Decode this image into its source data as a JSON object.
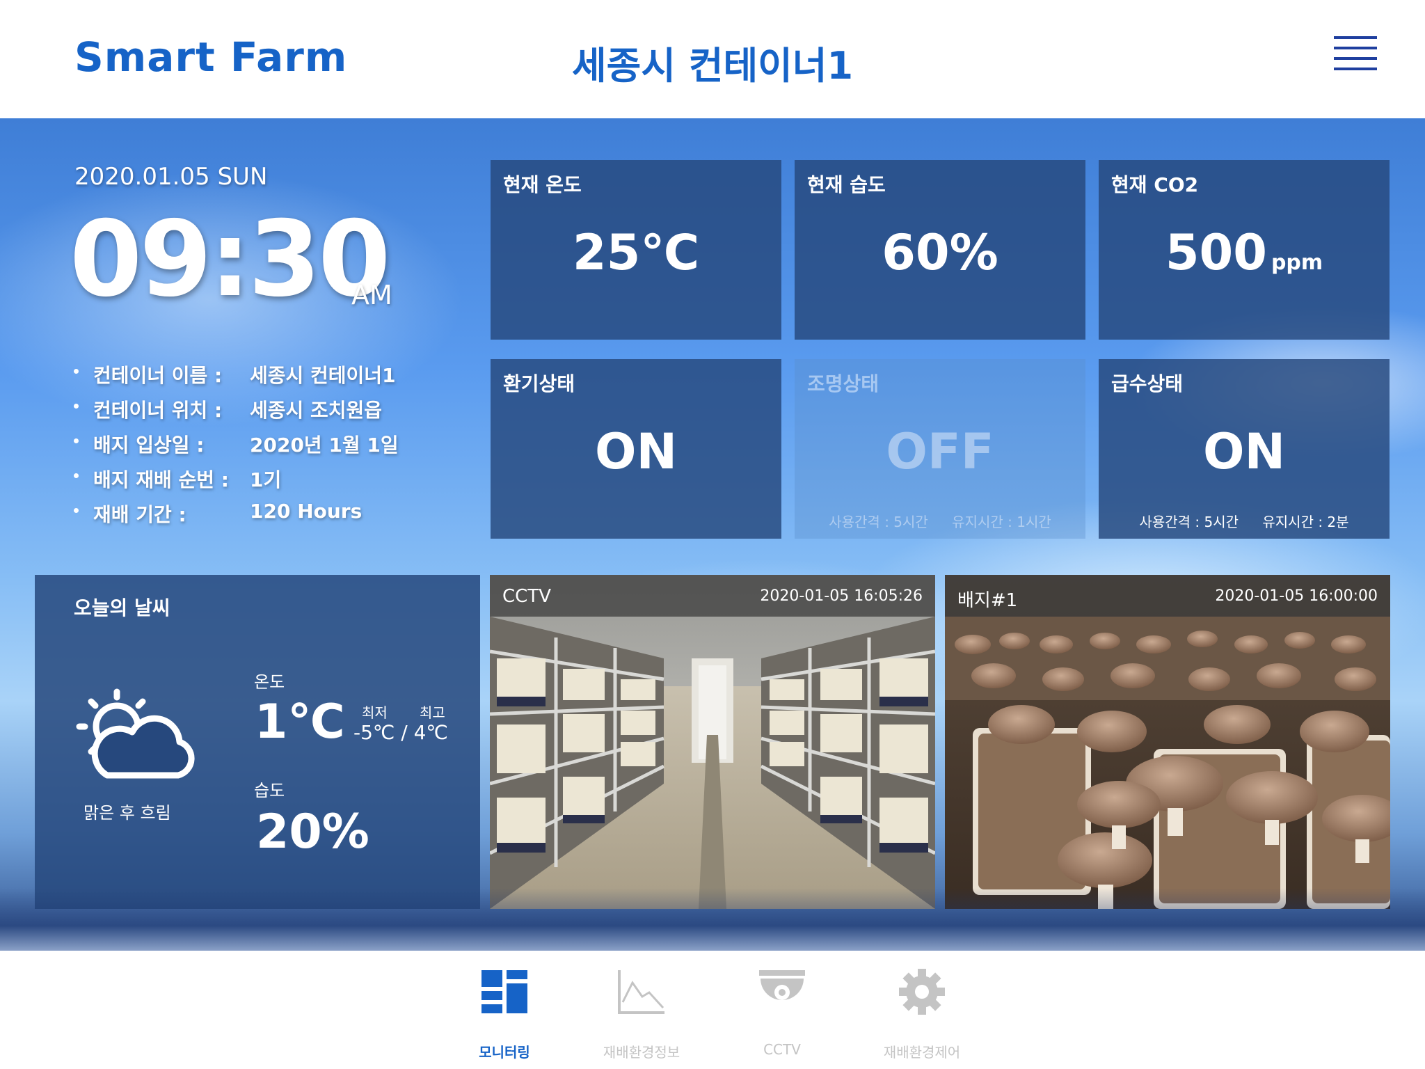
{
  "header": {
    "logo": "Smart Farm",
    "title": "세종시 컨테이너1",
    "menu_icon": "hamburger-menu-icon"
  },
  "clock": {
    "date": "2020.01.05 SUN",
    "time": "09:30",
    "ampm": "AM"
  },
  "info": [
    {
      "label": "컨테이너 이름 :",
      "value": "세종시 컨테이너1"
    },
    {
      "label": "컨테이너 위치 :",
      "value": "세종시 조치원읍"
    },
    {
      "label": "배지 입상일 :",
      "value": "2020년 1월 1일"
    },
    {
      "label": "배지 재배 순번 :",
      "value": "1기"
    },
    {
      "label": "재배 기간 :",
      "value": "120 Hours"
    }
  ],
  "cards": {
    "temp": {
      "title": "현재 온도",
      "value": "25℃"
    },
    "humidity": {
      "title": "현재 습도",
      "value": "60%"
    },
    "co2": {
      "title": "현재 CO2",
      "value": "500",
      "unit": "ppm"
    },
    "ventilation": {
      "title": "환기상태",
      "value": "ON"
    },
    "lighting": {
      "title": "조명상태",
      "value": "OFF",
      "interval": "사용간격 : 5시간",
      "duration": "유지시간 : 1시간"
    },
    "water": {
      "title": "급수상태",
      "value": "ON",
      "interval": "사용간격 : 5시간",
      "duration": "유지시간 : 2분"
    }
  },
  "weather": {
    "title": "오늘의 날씨",
    "icon": "sun-behind-cloud-icon",
    "description": "맑은 후 흐림",
    "temp_label": "온도",
    "temp": "1℃",
    "min_label": "최저",
    "max_label": "최고",
    "min_max": "-5℃ / 4℃",
    "humidity_label": "습도",
    "humidity": "20%"
  },
  "cameras": [
    {
      "name": "CCTV",
      "timestamp": "2020-01-05 16:05:26"
    },
    {
      "name": "배지#1",
      "timestamp": "2020-01-05 16:00:00"
    }
  ],
  "nav": {
    "items": [
      {
        "label": "모니터링",
        "icon": "dashboard-grid-icon",
        "active": true
      },
      {
        "label": "재배환경정보",
        "icon": "line-chart-icon",
        "active": false
      },
      {
        "label": "CCTV",
        "icon": "cctv-dome-camera-icon",
        "active": false
      },
      {
        "label": "재배환경제어",
        "icon": "gear-icon",
        "active": false
      }
    ]
  },
  "colors": {
    "brand_blue": "#1663c7",
    "card_bg": "#26487d",
    "nav_inactive": "#c4c4c4"
  }
}
